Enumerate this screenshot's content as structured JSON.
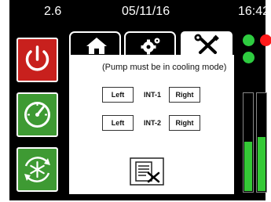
{
  "status_bar": {
    "version": "2.6",
    "date": "05/11/16",
    "time": "16:42"
  },
  "sidebar": {
    "buttons": [
      {
        "name": "power",
        "icon": "power-icon",
        "color": "#c8201d"
      },
      {
        "name": "gauge",
        "icon": "gauge-icon",
        "color": "#3e9a33"
      },
      {
        "name": "cooling",
        "icon": "snowflake-cycle-icon",
        "color": "#3e9a33"
      }
    ]
  },
  "tabs": [
    {
      "name": "home",
      "icon": "home-icon",
      "active": false
    },
    {
      "name": "settings",
      "icon": "gears-icon",
      "active": false
    },
    {
      "name": "tools",
      "icon": "wrench-screwdriver-icon",
      "active": true
    }
  ],
  "content": {
    "note": "(Pump must be in cooling mode)",
    "rows": [
      {
        "label": "INT-1",
        "left_label": "Left",
        "right_label": "Right"
      },
      {
        "label": "INT-2",
        "left_label": "Left",
        "right_label": "Right"
      }
    ],
    "tool_icon": "checklist-tools-icon"
  },
  "indicators": {
    "lights": [
      {
        "name": "light-1",
        "color": "#2ecc40"
      },
      {
        "name": "light-2",
        "color": "#ff1a1a"
      },
      {
        "name": "light-3",
        "color": "#2ecc40"
      }
    ],
    "meters": [
      {
        "name": "meter-1",
        "level": 0.5,
        "color": "#34c936"
      },
      {
        "name": "meter-2",
        "level": 0.55,
        "color": "#34c936"
      }
    ]
  }
}
